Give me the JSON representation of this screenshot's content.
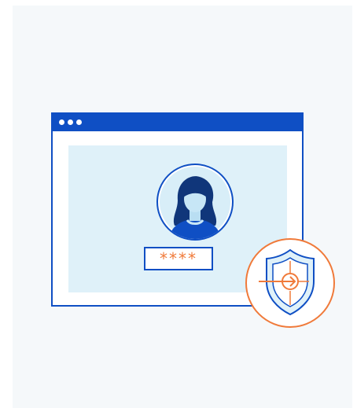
{
  "login_illustration": {
    "password_field": {
      "value": "****"
    },
    "window_controls": [
      "dot",
      "dot",
      "dot"
    ],
    "icons": {
      "avatar": "user-avatar-icon",
      "security": "shield-login-icon"
    },
    "colors": {
      "primary": "#0f4fc4",
      "accent": "#f07a3a",
      "content_bg": "#dff1f9",
      "panel_bg": "#f5f8fa"
    }
  }
}
